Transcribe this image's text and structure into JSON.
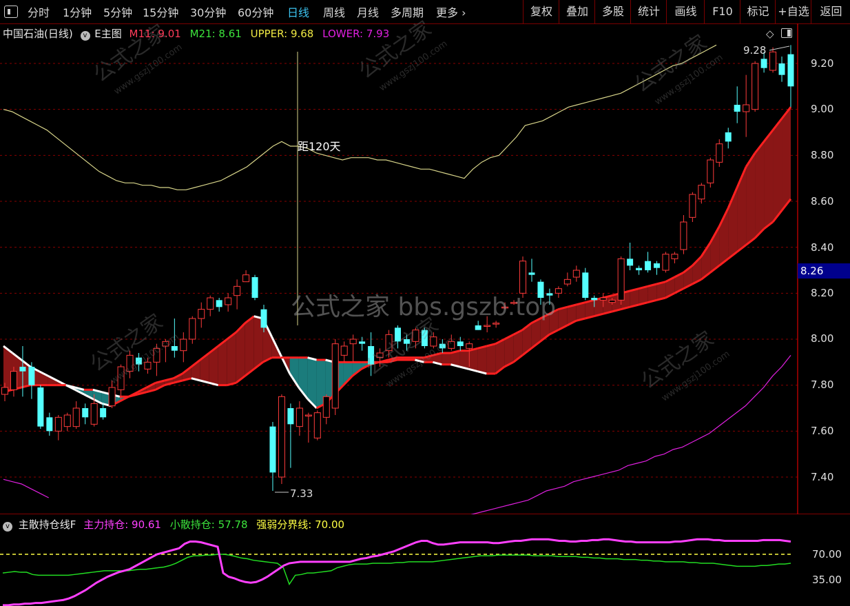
{
  "toolbar": {
    "menu_label": "菜单",
    "periods": [
      "分时",
      "1分钟",
      "5分钟",
      "15分钟",
      "30分钟",
      "60分钟",
      "日线",
      "周线",
      "月线",
      "多周期",
      "更多"
    ],
    "more_arrow": "›",
    "active_period": "日线",
    "right_buttons": [
      "复权",
      "叠加",
      "多股",
      "统计",
      "画线",
      "F10",
      "标记",
      "+自选",
      "返回"
    ]
  },
  "main_legend": {
    "stock": "中国石油(日线)",
    "indicator": "E主图",
    "m11_label": "M11: 9.01",
    "m21_label": "M21: 8.61",
    "upper_label": "UPPER: 9.68",
    "lower_label": "LOWER: 7.93"
  },
  "sub_legend": {
    "indicator": "主散持仓线F",
    "main_label": "主力持仓: 90.61",
    "retail_label": "小散持仓: 57.78",
    "boundary_label": "强弱分界线: 70.00"
  },
  "annotations": {
    "crosshair_days": "距120天",
    "high": "9.28",
    "low": "7.33",
    "watermark_center": "公式之家 bbs.gszb.top",
    "watermark_cn": "公式之家",
    "watermark_url": "www.gszj100.com"
  },
  "price_axis": {
    "labels": [
      "9.20",
      "9.00",
      "8.80",
      "8.60",
      "8.40",
      "8.20",
      "8.00",
      "7.80",
      "7.60",
      "7.40"
    ],
    "current": "8.26"
  },
  "sub_axis": {
    "labels": [
      "70.00",
      "35.00"
    ]
  },
  "colors": {
    "up": "#ff3b3b",
    "down": "#54ffff",
    "upper": "#d8d58a",
    "lower": "#e020e0",
    "bull_fill": "#8a1616",
    "bear_fill": "#1b7c7c",
    "main_force": "#ff40ff",
    "retail": "#22dd22",
    "boundary": "#ffff44",
    "grid": "#8a0000"
  },
  "chart_data": {
    "type": "candlestick",
    "title": "中国石油(日线)",
    "ylim": [
      7.3,
      9.31
    ],
    "candles": [
      [
        7.76,
        7.79,
        7.73,
        7.81
      ],
      [
        7.78,
        7.86,
        7.75,
        7.88
      ],
      [
        7.88,
        7.86,
        7.75,
        7.97
      ],
      [
        7.88,
        7.8,
        7.74,
        7.9
      ],
      [
        7.79,
        7.62,
        7.61,
        7.8
      ],
      [
        7.66,
        7.6,
        7.58,
        7.68
      ],
      [
        7.6,
        7.66,
        7.56,
        7.67
      ],
      [
        7.62,
        7.67,
        7.6,
        7.68
      ],
      [
        7.62,
        7.7,
        7.61,
        7.73
      ],
      [
        7.7,
        7.66,
        7.63,
        7.72
      ],
      [
        7.63,
        7.72,
        7.62,
        7.76
      ],
      [
        7.7,
        7.66,
        7.65,
        7.72
      ],
      [
        7.71,
        7.79,
        7.7,
        7.82
      ],
      [
        7.78,
        7.88,
        7.74,
        7.89
      ],
      [
        7.86,
        7.93,
        7.83,
        7.95
      ],
      [
        7.92,
        7.89,
        7.86,
        7.94
      ],
      [
        7.87,
        7.9,
        7.85,
        7.92
      ],
      [
        7.9,
        7.96,
        7.84,
        7.98
      ],
      [
        7.97,
        7.99,
        7.9,
        8.0
      ],
      [
        7.97,
        7.95,
        7.92,
        8.09
      ],
      [
        7.95,
        8.0,
        7.9,
        8.03
      ],
      [
        8.0,
        8.09,
        7.98,
        8.1
      ],
      [
        8.09,
        8.13,
        8.05,
        8.16
      ],
      [
        8.13,
        8.18,
        8.1,
        8.19
      ],
      [
        8.17,
        8.14,
        8.12,
        8.18
      ],
      [
        8.15,
        8.18,
        8.12,
        8.2
      ],
      [
        8.19,
        8.23,
        8.13,
        8.26
      ],
      [
        8.25,
        8.28,
        8.25,
        8.3
      ],
      [
        8.27,
        8.18,
        8.17,
        8.28
      ],
      [
        8.13,
        8.05,
        8.03,
        8.15
      ],
      [
        7.62,
        7.42,
        7.34,
        7.64
      ],
      [
        7.4,
        7.75,
        7.37,
        7.76
      ],
      [
        7.7,
        7.63,
        7.44,
        7.72
      ],
      [
        7.62,
        7.7,
        7.58,
        7.73
      ],
      [
        7.67,
        7.67,
        7.55,
        7.68
      ],
      [
        7.57,
        7.68,
        7.56,
        7.69
      ],
      [
        7.66,
        7.75,
        7.63,
        7.76
      ],
      [
        7.7,
        7.98,
        7.67,
        8.0
      ],
      [
        7.93,
        7.97,
        7.9,
        7.99
      ],
      [
        7.98,
        8.0,
        7.9,
        8.02
      ],
      [
        7.99,
        7.98,
        7.95,
        8.01
      ],
      [
        7.97,
        7.89,
        7.84,
        8.03
      ],
      [
        7.92,
        7.94,
        7.88,
        7.96
      ],
      [
        7.95,
        8.02,
        7.92,
        8.04
      ],
      [
        8.05,
        7.99,
        7.96,
        8.06
      ],
      [
        8.0,
        7.98,
        7.95,
        8.02
      ],
      [
        7.99,
        8.04,
        7.96,
        8.05
      ],
      [
        8.04,
        7.97,
        7.96,
        8.05
      ],
      [
        7.97,
        8.01,
        7.96,
        8.03
      ],
      [
        7.98,
        7.96,
        7.94,
        8.0
      ],
      [
        7.96,
        7.99,
        7.95,
        8.02
      ],
      [
        7.99,
        7.97,
        7.95,
        8.01
      ],
      [
        7.96,
        7.98,
        7.88,
        7.99
      ],
      [
        8.06,
        8.04,
        8.04,
        8.08
      ],
      [
        8.06,
        8.06,
        8.03,
        8.1
      ],
      [
        8.07,
        8.07,
        8.05,
        8.08
      ],
      [
        8.14,
        8.14,
        8.13,
        8.16
      ],
      [
        8.16,
        8.16,
        8.15,
        8.17
      ],
      [
        8.2,
        8.34,
        8.18,
        8.36
      ],
      [
        8.29,
        8.28,
        8.25,
        8.35
      ],
      [
        8.25,
        8.18,
        8.15,
        8.26
      ],
      [
        8.2,
        8.19,
        8.15,
        8.22
      ],
      [
        8.2,
        8.22,
        8.18,
        8.23
      ],
      [
        8.24,
        8.26,
        8.23,
        8.29
      ],
      [
        8.27,
        8.3,
        8.25,
        8.32
      ],
      [
        8.29,
        8.18,
        8.17,
        8.31
      ],
      [
        8.18,
        8.17,
        8.14,
        8.19
      ],
      [
        8.17,
        8.18,
        8.14,
        8.2
      ],
      [
        8.16,
        8.17,
        8.15,
        8.18
      ],
      [
        8.17,
        8.35,
        8.15,
        8.36
      ],
      [
        8.35,
        8.32,
        8.3,
        8.42
      ],
      [
        8.31,
        8.3,
        8.28,
        8.32
      ],
      [
        8.34,
        8.3,
        8.29,
        8.38
      ],
      [
        8.33,
        8.31,
        8.28,
        8.34
      ],
      [
        8.3,
        8.37,
        8.29,
        8.38
      ],
      [
        8.35,
        8.37,
        8.33,
        8.38
      ],
      [
        8.39,
        8.51,
        8.37,
        8.54
      ],
      [
        8.53,
        8.63,
        8.51,
        8.64
      ],
      [
        8.61,
        8.67,
        8.59,
        8.68
      ],
      [
        8.68,
        8.78,
        8.66,
        8.79
      ],
      [
        8.77,
        8.85,
        8.75,
        8.87
      ],
      [
        8.9,
        8.86,
        8.83,
        8.92
      ],
      [
        9.02,
        8.99,
        8.94,
        9.1
      ],
      [
        8.99,
        9.02,
        8.88,
        9.15
      ],
      [
        9.0,
        9.2,
        8.99,
        9.21
      ],
      [
        9.22,
        9.18,
        9.16,
        9.25
      ],
      [
        9.17,
        9.25,
        9.16,
        9.27
      ],
      [
        9.2,
        9.15,
        9.12,
        9.23
      ],
      [
        9.24,
        9.1,
        9.01,
        9.28
      ]
    ],
    "series": [
      {
        "name": "M11",
        "values": [
          7.97,
          7.94,
          7.91,
          7.88,
          7.86,
          7.84,
          7.82,
          7.8,
          7.78,
          7.76,
          7.74,
          7.72,
          7.71,
          7.73,
          7.75,
          7.77,
          7.79,
          7.81,
          7.82,
          7.83,
          7.85,
          7.88,
          7.91,
          7.94,
          7.97,
          8.0,
          8.03,
          8.07,
          8.1,
          8.09,
          8.01,
          7.93,
          7.85,
          7.79,
          7.74,
          7.7,
          7.72,
          7.76,
          7.8,
          7.84,
          7.87,
          7.89,
          7.9,
          7.91,
          7.92,
          7.92,
          7.92,
          7.92,
          7.93,
          7.94,
          7.94,
          7.95,
          7.95,
          7.96,
          7.97,
          7.98,
          8.0,
          8.02,
          8.04,
          8.07,
          8.09,
          8.11,
          8.13,
          8.14,
          8.15,
          8.16,
          8.17,
          8.18,
          8.19,
          8.2,
          8.21,
          8.22,
          8.23,
          8.24,
          8.25,
          8.27,
          8.29,
          8.32,
          8.36,
          8.42,
          8.49,
          8.57,
          8.66,
          8.75,
          8.81,
          8.86,
          8.91,
          8.96,
          9.01
        ]
      },
      {
        "name": "M21",
        "values": [
          7.77,
          7.78,
          7.79,
          7.8,
          7.8,
          7.8,
          7.8,
          7.8,
          7.79,
          7.78,
          7.78,
          7.77,
          7.76,
          7.75,
          7.75,
          7.76,
          7.77,
          7.78,
          7.8,
          7.81,
          7.82,
          7.83,
          7.82,
          7.81,
          7.8,
          7.8,
          7.81,
          7.84,
          7.87,
          7.9,
          7.92,
          7.92,
          7.92,
          7.92,
          7.92,
          7.91,
          7.91,
          7.9,
          7.9,
          7.9,
          7.9,
          7.9,
          7.9,
          7.9,
          7.91,
          7.91,
          7.91,
          7.9,
          7.9,
          7.89,
          7.89,
          7.88,
          7.87,
          7.86,
          7.85,
          7.85,
          7.88,
          7.9,
          7.93,
          7.96,
          7.99,
          8.02,
          8.04,
          8.06,
          8.08,
          8.09,
          8.1,
          8.11,
          8.12,
          8.13,
          8.14,
          8.15,
          8.16,
          8.17,
          8.18,
          8.2,
          8.22,
          8.24,
          8.26,
          8.29,
          8.32,
          8.35,
          8.38,
          8.41,
          8.44,
          8.48,
          8.51,
          8.56,
          8.61
        ]
      },
      {
        "name": "UPPER",
        "values": [
          9.0,
          8.99,
          8.97,
          8.95,
          8.93,
          8.91,
          8.88,
          8.85,
          8.82,
          8.79,
          8.76,
          8.73,
          8.71,
          8.69,
          8.68,
          8.68,
          8.67,
          8.67,
          8.66,
          8.66,
          8.65,
          8.65,
          8.66,
          8.67,
          8.68,
          8.69,
          8.71,
          8.73,
          8.75,
          8.78,
          8.81,
          8.84,
          8.86,
          8.84,
          8.84,
          8.83,
          8.81,
          8.8,
          8.79,
          8.78,
          8.79,
          8.79,
          8.79,
          8.78,
          8.78,
          8.77,
          8.76,
          8.75,
          8.74,
          8.74,
          8.73,
          8.72,
          8.71,
          8.7,
          8.74,
          8.77,
          8.79,
          8.8,
          8.84,
          8.88,
          8.93,
          8.94,
          8.95,
          8.97,
          8.99,
          9.01,
          9.02,
          9.03,
          9.04,
          9.05,
          9.06,
          9.07,
          9.09,
          9.11,
          9.13,
          9.15,
          9.17,
          9.19,
          9.2,
          9.22,
          9.24,
          9.26,
          9.28
        ]
      },
      {
        "name": "LOWER",
        "values": [
          7.39,
          7.38,
          7.37,
          7.35,
          7.33,
          7.31,
          7.29,
          7.27,
          7.25,
          7.23,
          7.21,
          7.19,
          7.17,
          7.15,
          7.14,
          7.13,
          7.12,
          7.12,
          7.12,
          7.13,
          7.14,
          7.16,
          7.18,
          7.2,
          7.22,
          7.24,
          7.26,
          7.28,
          7.3,
          7.28,
          7.24,
          7.2,
          7.16,
          7.12,
          7.1,
          7.08,
          7.08,
          7.09,
          7.1,
          7.11,
          7.12,
          7.13,
          7.14,
          7.15,
          7.16,
          7.17,
          7.18,
          7.19,
          7.2,
          7.21,
          7.22,
          7.23,
          7.24,
          7.25,
          7.26,
          7.27,
          7.28,
          7.29,
          7.3,
          7.32,
          7.34,
          7.35,
          7.36,
          7.38,
          7.39,
          7.4,
          7.41,
          7.42,
          7.43,
          7.45,
          7.46,
          7.47,
          7.49,
          7.5,
          7.52,
          7.53,
          7.55,
          7.57,
          7.59,
          7.62,
          7.65,
          7.68,
          7.71,
          7.75,
          7.79,
          7.84,
          7.88,
          7.93
        ]
      },
      {
        "name": "主力持仓",
        "values": [
          2,
          2,
          3,
          3,
          4,
          4,
          5,
          5,
          6,
          7,
          8,
          9,
          11,
          14,
          18,
          22,
          27,
          32,
          36,
          40,
          43,
          46,
          48,
          50,
          54,
          58,
          62,
          66,
          70,
          72,
          74,
          76,
          78,
          84,
          87,
          87,
          86,
          84,
          82,
          80,
          45,
          40,
          38,
          35,
          33,
          32,
          33,
          36,
          40,
          45,
          50,
          55,
          58,
          59,
          60,
          60,
          60,
          60,
          60,
          60,
          60,
          60,
          60,
          60,
          62,
          64,
          65,
          67,
          68,
          70,
          72,
          74,
          77,
          80,
          83,
          86,
          88,
          88,
          85,
          83,
          83,
          84,
          85,
          86,
          86,
          86,
          86,
          86,
          86,
          85,
          85,
          86,
          87,
          88,
          88,
          89,
          90,
          90,
          90,
          90,
          89,
          88,
          88,
          87,
          87,
          88,
          88,
          89,
          89,
          90,
          90,
          89,
          88,
          87,
          87,
          86,
          86,
          86,
          86,
          86,
          86,
          86,
          87,
          87,
          88,
          89,
          90,
          90,
          90,
          89,
          89,
          88,
          88,
          88,
          88,
          88,
          88,
          88,
          89,
          89,
          89,
          89,
          88,
          87
        ]
      },
      {
        "name": "小散持仓",
        "values": [
          45,
          46,
          47,
          46,
          46,
          43,
          42,
          42,
          42,
          42,
          42,
          42,
          43,
          44,
          45,
          46,
          47,
          48,
          48,
          48,
          48,
          48,
          49,
          50,
          50,
          51,
          52,
          53,
          55,
          58,
          62,
          66,
          68,
          68,
          69,
          69,
          70,
          70,
          69,
          67,
          65,
          64,
          62,
          61,
          60,
          59,
          58,
          52,
          30,
          42,
          43,
          45,
          45,
          46,
          47,
          48,
          52,
          54,
          56,
          57,
          57,
          57,
          58,
          58,
          58,
          58,
          59,
          59,
          60,
          60,
          60,
          60,
          60,
          61,
          62,
          63,
          64,
          65,
          66,
          67,
          68,
          68,
          68,
          69,
          69,
          69,
          69,
          69,
          69,
          68,
          68,
          68,
          68,
          67,
          67,
          67,
          67,
          66,
          66,
          65,
          65,
          64,
          64,
          64,
          63,
          63,
          63,
          62,
          62,
          61,
          61,
          60,
          60,
          60,
          60,
          59,
          59,
          58,
          58,
          58,
          57,
          56,
          55,
          54,
          54,
          54,
          54,
          55,
          55,
          56,
          57,
          57,
          58
        ]
      },
      {
        "name": "强弱分界线",
        "values": [
          70
        ]
      }
    ]
  }
}
